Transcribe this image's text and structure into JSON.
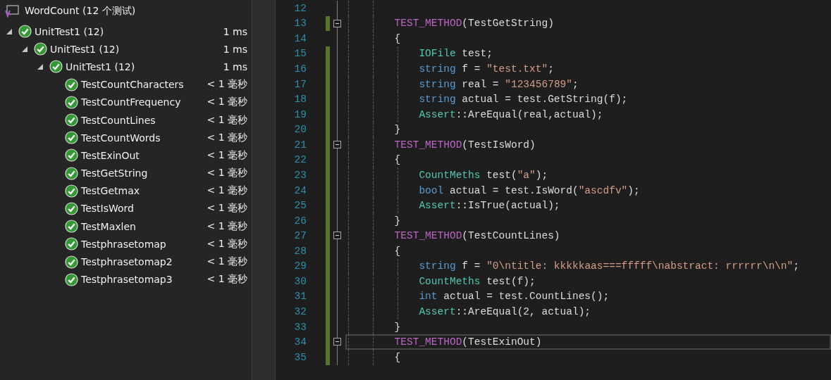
{
  "explorer": {
    "title": "WordCount (12 个测试)",
    "tree": [
      {
        "name": "UnitTest1 (12)",
        "duration": "1 ms",
        "passed": true,
        "expanded": true,
        "children": [
          {
            "name": "UnitTest1 (12)",
            "duration": "1 ms",
            "passed": true,
            "expanded": true,
            "children": [
              {
                "name": "UnitTest1 (12)",
                "duration": "1 ms",
                "passed": true,
                "expanded": true,
                "children": [
                  {
                    "name": "TestCountCharacters",
                    "duration": "< 1 毫秒",
                    "passed": true
                  },
                  {
                    "name": "TestCountFrequency",
                    "duration": "< 1 毫秒",
                    "passed": true
                  },
                  {
                    "name": "TestCountLines",
                    "duration": "< 1 毫秒",
                    "passed": true
                  },
                  {
                    "name": "TestCountWords",
                    "duration": "< 1 毫秒",
                    "passed": true
                  },
                  {
                    "name": "TestExinOut",
                    "duration": "< 1 毫秒",
                    "passed": true
                  },
                  {
                    "name": "TestGetString",
                    "duration": "< 1 毫秒",
                    "passed": true
                  },
                  {
                    "name": "TestGetmax",
                    "duration": "< 1 毫秒",
                    "passed": true
                  },
                  {
                    "name": "TestIsWord",
                    "duration": "< 1 毫秒",
                    "passed": true
                  },
                  {
                    "name": "TestMaxlen",
                    "duration": "< 1 毫秒",
                    "passed": true
                  },
                  {
                    "name": "Testphrasetomap",
                    "duration": "< 1 毫秒",
                    "passed": true
                  },
                  {
                    "name": "Testphrasetomap2",
                    "duration": "< 1 毫秒",
                    "passed": true
                  },
                  {
                    "name": "Testphrasetomap3",
                    "duration": "< 1 毫秒",
                    "passed": true
                  }
                ]
              }
            ]
          }
        ]
      }
    ]
  },
  "editor": {
    "lines": [
      {
        "number": "12",
        "changed": false,
        "fold": false,
        "current": false
      },
      {
        "number": "13",
        "changed": true,
        "fold": true,
        "current": false,
        "tokens": [
          {
            "kind": "macro",
            "text": "        TEST_METHOD"
          },
          {
            "kind": "plain",
            "text": "(TestGetString)"
          }
        ]
      },
      {
        "number": "14",
        "changed": false,
        "fold": false,
        "current": false,
        "tokens": [
          {
            "kind": "plain",
            "text": "        {"
          }
        ]
      },
      {
        "number": "15",
        "changed": true,
        "fold": false,
        "current": false,
        "tokens": [
          {
            "kind": "type",
            "text": "            IOFile"
          },
          {
            "kind": "plain",
            "text": " test;"
          }
        ]
      },
      {
        "number": "16",
        "changed": true,
        "fold": false,
        "current": false,
        "tokens": [
          {
            "kind": "keyword",
            "text": "            string"
          },
          {
            "kind": "plain",
            "text": " f = "
          },
          {
            "kind": "string",
            "text": "\"test.txt\""
          },
          {
            "kind": "plain",
            "text": ";"
          }
        ]
      },
      {
        "number": "17",
        "changed": true,
        "fold": false,
        "current": false,
        "tokens": [
          {
            "kind": "keyword",
            "text": "            string"
          },
          {
            "kind": "plain",
            "text": " real = "
          },
          {
            "kind": "string",
            "text": "\"123456789\""
          },
          {
            "kind": "plain",
            "text": ";"
          }
        ]
      },
      {
        "number": "18",
        "changed": true,
        "fold": false,
        "current": false,
        "tokens": [
          {
            "kind": "keyword",
            "text": "            string"
          },
          {
            "kind": "plain",
            "text": " actual = test.GetString(f);"
          }
        ]
      },
      {
        "number": "19",
        "changed": true,
        "fold": false,
        "current": false,
        "tokens": [
          {
            "kind": "type",
            "text": "            Assert"
          },
          {
            "kind": "plain",
            "text": "::AreEqual(real,actual);"
          }
        ]
      },
      {
        "number": "20",
        "changed": true,
        "fold": false,
        "current": false,
        "tokens": [
          {
            "kind": "plain",
            "text": "        }"
          }
        ]
      },
      {
        "number": "21",
        "changed": true,
        "fold": true,
        "current": false,
        "tokens": [
          {
            "kind": "macro",
            "text": "        TEST_METHOD"
          },
          {
            "kind": "plain",
            "text": "(TestIsWord)"
          }
        ]
      },
      {
        "number": "22",
        "changed": true,
        "fold": false,
        "current": false,
        "tokens": [
          {
            "kind": "plain",
            "text": "        {"
          }
        ]
      },
      {
        "number": "23",
        "changed": true,
        "fold": false,
        "current": false,
        "tokens": [
          {
            "kind": "type",
            "text": "            CountMeths"
          },
          {
            "kind": "plain",
            "text": " test("
          },
          {
            "kind": "string",
            "text": "\"a\""
          },
          {
            "kind": "plain",
            "text": ");"
          }
        ]
      },
      {
        "number": "24",
        "changed": true,
        "fold": false,
        "current": false,
        "tokens": [
          {
            "kind": "keyword",
            "text": "            bool"
          },
          {
            "kind": "plain",
            "text": " actual = test.IsWord("
          },
          {
            "kind": "string",
            "text": "\"ascdfv\""
          },
          {
            "kind": "plain",
            "text": ");"
          }
        ]
      },
      {
        "number": "25",
        "changed": true,
        "fold": false,
        "current": false,
        "tokens": [
          {
            "kind": "type",
            "text": "            Assert"
          },
          {
            "kind": "plain",
            "text": "::IsTrue(actual);"
          }
        ]
      },
      {
        "number": "26",
        "changed": true,
        "fold": false,
        "current": false,
        "tokens": [
          {
            "kind": "plain",
            "text": "        }"
          }
        ]
      },
      {
        "number": "27",
        "changed": true,
        "fold": true,
        "current": false,
        "tokens": [
          {
            "kind": "macro",
            "text": "        TEST_METHOD"
          },
          {
            "kind": "plain",
            "text": "(TestCountLines)"
          }
        ]
      },
      {
        "number": "28",
        "changed": true,
        "fold": false,
        "current": false,
        "tokens": [
          {
            "kind": "plain",
            "text": "        {"
          }
        ]
      },
      {
        "number": "29",
        "changed": true,
        "fold": false,
        "current": false,
        "tokens": [
          {
            "kind": "keyword",
            "text": "            string"
          },
          {
            "kind": "plain",
            "text": " f = "
          },
          {
            "kind": "string",
            "text": "\"0\\ntitle: kkkkkaas===fffff\\nabstract: rrrrrr\\n\\n\""
          },
          {
            "kind": "plain",
            "text": ";"
          }
        ]
      },
      {
        "number": "30",
        "changed": true,
        "fold": false,
        "current": false,
        "tokens": [
          {
            "kind": "type",
            "text": "            CountMeths"
          },
          {
            "kind": "plain",
            "text": " test(f);"
          }
        ]
      },
      {
        "number": "31",
        "changed": true,
        "fold": false,
        "current": false,
        "tokens": [
          {
            "kind": "keyword",
            "text": "            int"
          },
          {
            "kind": "plain",
            "text": " actual = test.CountLines();"
          }
        ]
      },
      {
        "number": "32",
        "changed": true,
        "fold": false,
        "current": false,
        "tokens": [
          {
            "kind": "type",
            "text": "            Assert"
          },
          {
            "kind": "plain",
            "text": "::AreEqual(2, actual);"
          }
        ]
      },
      {
        "number": "33",
        "changed": true,
        "fold": false,
        "current": false,
        "tokens": [
          {
            "kind": "plain",
            "text": "        }"
          }
        ]
      },
      {
        "number": "34",
        "changed": true,
        "fold": true,
        "current": true,
        "tokens": [
          {
            "kind": "macro",
            "text": "        TEST_METHOD"
          },
          {
            "kind": "plain",
            "text": "(TestExinOut)"
          }
        ]
      },
      {
        "number": "35",
        "changed": true,
        "fold": false,
        "current": false,
        "tokens": [
          {
            "kind": "plain",
            "text": "        {"
          }
        ]
      }
    ]
  }
}
